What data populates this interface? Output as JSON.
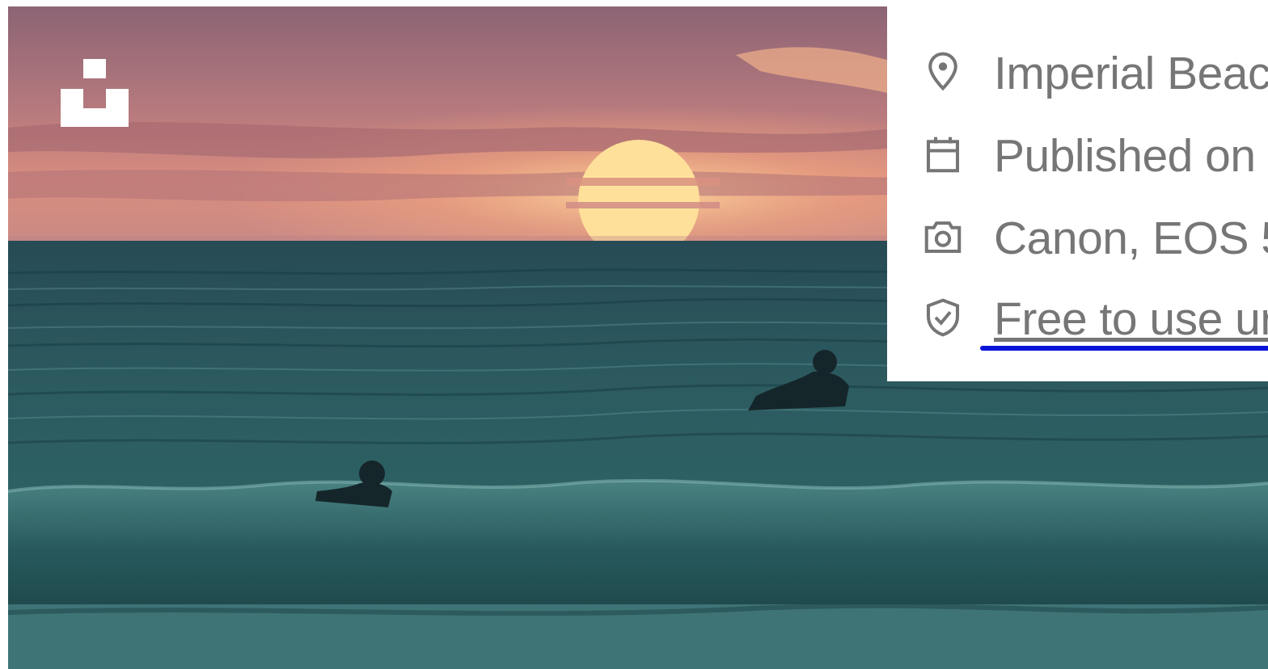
{
  "photo": {
    "subject": "surfers-at-sunset",
    "colors": {
      "sky_top": "#8f6677",
      "sky_glow": "#f0a07a",
      "sun": "#ffd98a",
      "sea_dark": "#1d4a4f",
      "sea_mid": "#2f6468",
      "foam": "#4f8585"
    }
  },
  "logo": {
    "icon": "unsplash-logo-icon"
  },
  "info": {
    "location": {
      "icon": "map-pin-icon",
      "text": "Imperial Beac"
    },
    "published": {
      "icon": "calendar-icon",
      "text": "Published on"
    },
    "camera": {
      "icon": "camera-icon",
      "text": "Canon, EOS 5"
    },
    "license": {
      "icon": "shield-check-icon",
      "text": "Free to use ur"
    }
  },
  "colors": {
    "text": "#767676",
    "focus": "#0a14d8"
  }
}
